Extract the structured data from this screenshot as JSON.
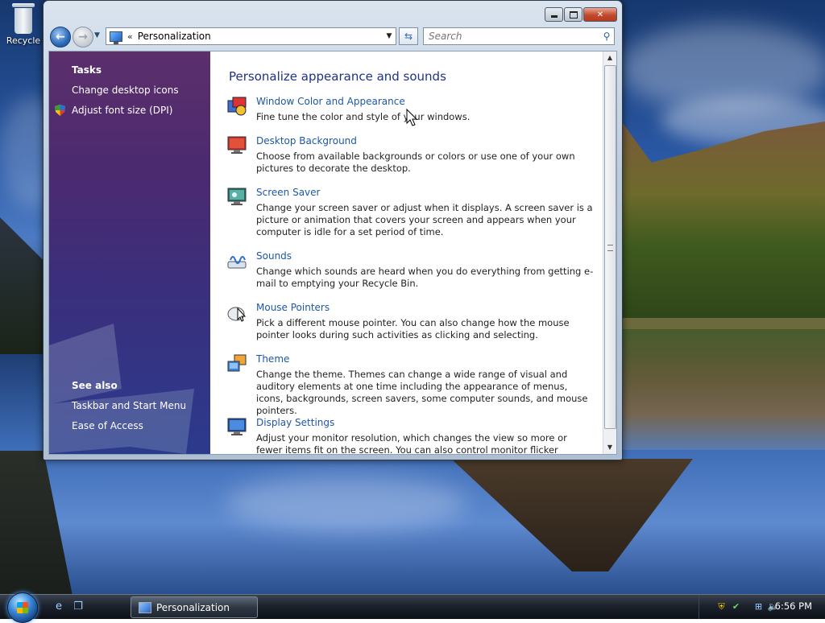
{
  "desktop": {
    "recycle_label": "Recycle"
  },
  "window": {
    "address": {
      "chevron": "«",
      "path": "Personalization"
    },
    "search": {
      "placeholder": "Search"
    },
    "sidebar": {
      "tasks_title": "Tasks",
      "tasks": [
        {
          "label": "Change desktop icons"
        },
        {
          "label": "Adjust font size (DPI)"
        }
      ],
      "see_also_title": "See also",
      "see_also": [
        {
          "label": "Taskbar and Start Menu"
        },
        {
          "label": "Ease of Access"
        }
      ]
    },
    "main": {
      "title": "Personalize appearance and sounds",
      "items": [
        {
          "title": "Window Color and Appearance",
          "desc": "Fine tune the color and style of your windows.",
          "icon": "window-color-icon"
        },
        {
          "title": "Desktop Background",
          "desc": "Choose from available backgrounds or colors or use one of your own pictures to decorate the desktop.",
          "icon": "desktop-background-icon"
        },
        {
          "title": "Screen Saver",
          "desc": "Change your screen saver or adjust when it displays. A screen saver is a picture or animation that covers your screen and appears when your computer is idle for a set period of time.",
          "icon": "screen-saver-icon"
        },
        {
          "title": "Sounds",
          "desc": "Change which sounds are heard when you do everything from getting e-mail to emptying your Recycle Bin.",
          "icon": "sounds-icon"
        },
        {
          "title": "Mouse Pointers",
          "desc": "Pick a different mouse pointer. You can also change how the mouse pointer looks during such activities as clicking and selecting.",
          "icon": "mouse-pointers-icon"
        },
        {
          "title": "Theme",
          "desc": "Change the theme. Themes can change a wide range of visual and auditory elements at one time including the appearance of menus, icons, backgrounds, screen savers, some computer sounds, and mouse pointers.",
          "icon": "theme-icon"
        },
        {
          "title": "Display Settings",
          "desc": "Adjust your monitor resolution, which changes the view so more or fewer items fit on the screen. You can also control monitor flicker (refresh rate).",
          "icon": "display-settings-icon"
        }
      ]
    }
  },
  "taskbar": {
    "active_task": "Personalization",
    "clock": "6:56 PM"
  },
  "colors": {
    "link": "#1e57a5",
    "title": "#1e3287",
    "sidebar_top": "#5c2f6b",
    "sidebar_bottom": "#2c3a8c"
  }
}
